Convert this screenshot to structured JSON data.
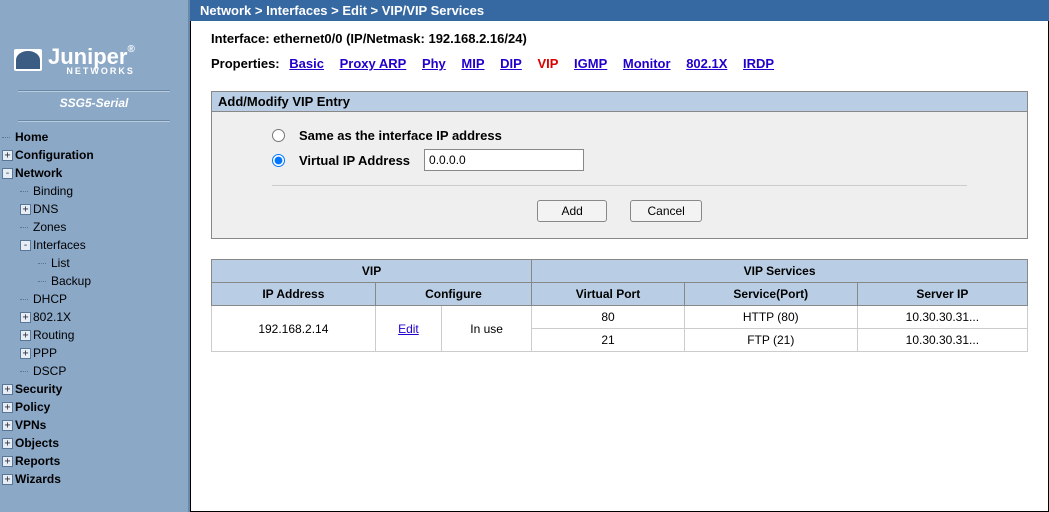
{
  "breadcrumb": "Network > Interfaces > Edit > VIP/VIP Services",
  "interface_line": "Interface: ethernet0/0 (IP/Netmask: 192.168.2.16/24)",
  "properties": {
    "label": "Properties:",
    "tabs": {
      "basic": "Basic",
      "proxyarp": "Proxy ARP",
      "phy": "Phy",
      "mip": "MIP",
      "dip": "DIP",
      "vip": "VIP",
      "igmp": "IGMP",
      "monitor": "Monitor",
      "dot1x": "802.1X",
      "irdp": "IRDP"
    },
    "active": "vip"
  },
  "panel": {
    "title": "Add/Modify VIP Entry",
    "opt_same": "Same as the interface IP address",
    "opt_vip": "Virtual IP Address",
    "vip_value": "0.0.0.0",
    "btn_add": "Add",
    "btn_cancel": "Cancel"
  },
  "table": {
    "hd_vip": "VIP",
    "hd_services": "VIP Services",
    "col_ip": "IP Address",
    "col_conf": "Configure",
    "col_vport": "Virtual Port",
    "col_service": "Service(Port)",
    "col_server": "Server IP",
    "row": {
      "ip": "192.168.2.14",
      "edit": "Edit",
      "inuse": "In use",
      "svc1": {
        "vport": "80",
        "service": "HTTP (80)",
        "server": "10.30.30.31..."
      },
      "svc2": {
        "vport": "21",
        "service": "FTP (21)",
        "server": "10.30.30.31..."
      }
    }
  },
  "sidebar": {
    "model": "SSG5-Serial",
    "logo_text": "Juniper",
    "logo_sub": "NETWORKS",
    "items": {
      "home": "Home",
      "configuration": "Configuration",
      "network": "Network",
      "binding": "Binding",
      "dns": "DNS",
      "zones": "Zones",
      "interfaces": "Interfaces",
      "list": "List",
      "backup": "Backup",
      "dhcp": "DHCP",
      "dot1x": "802.1X",
      "routing": "Routing",
      "ppp": "PPP",
      "dscp": "DSCP",
      "security": "Security",
      "policy": "Policy",
      "vpns": "VPNs",
      "objects": "Objects",
      "reports": "Reports",
      "wizards": "Wizards"
    }
  }
}
